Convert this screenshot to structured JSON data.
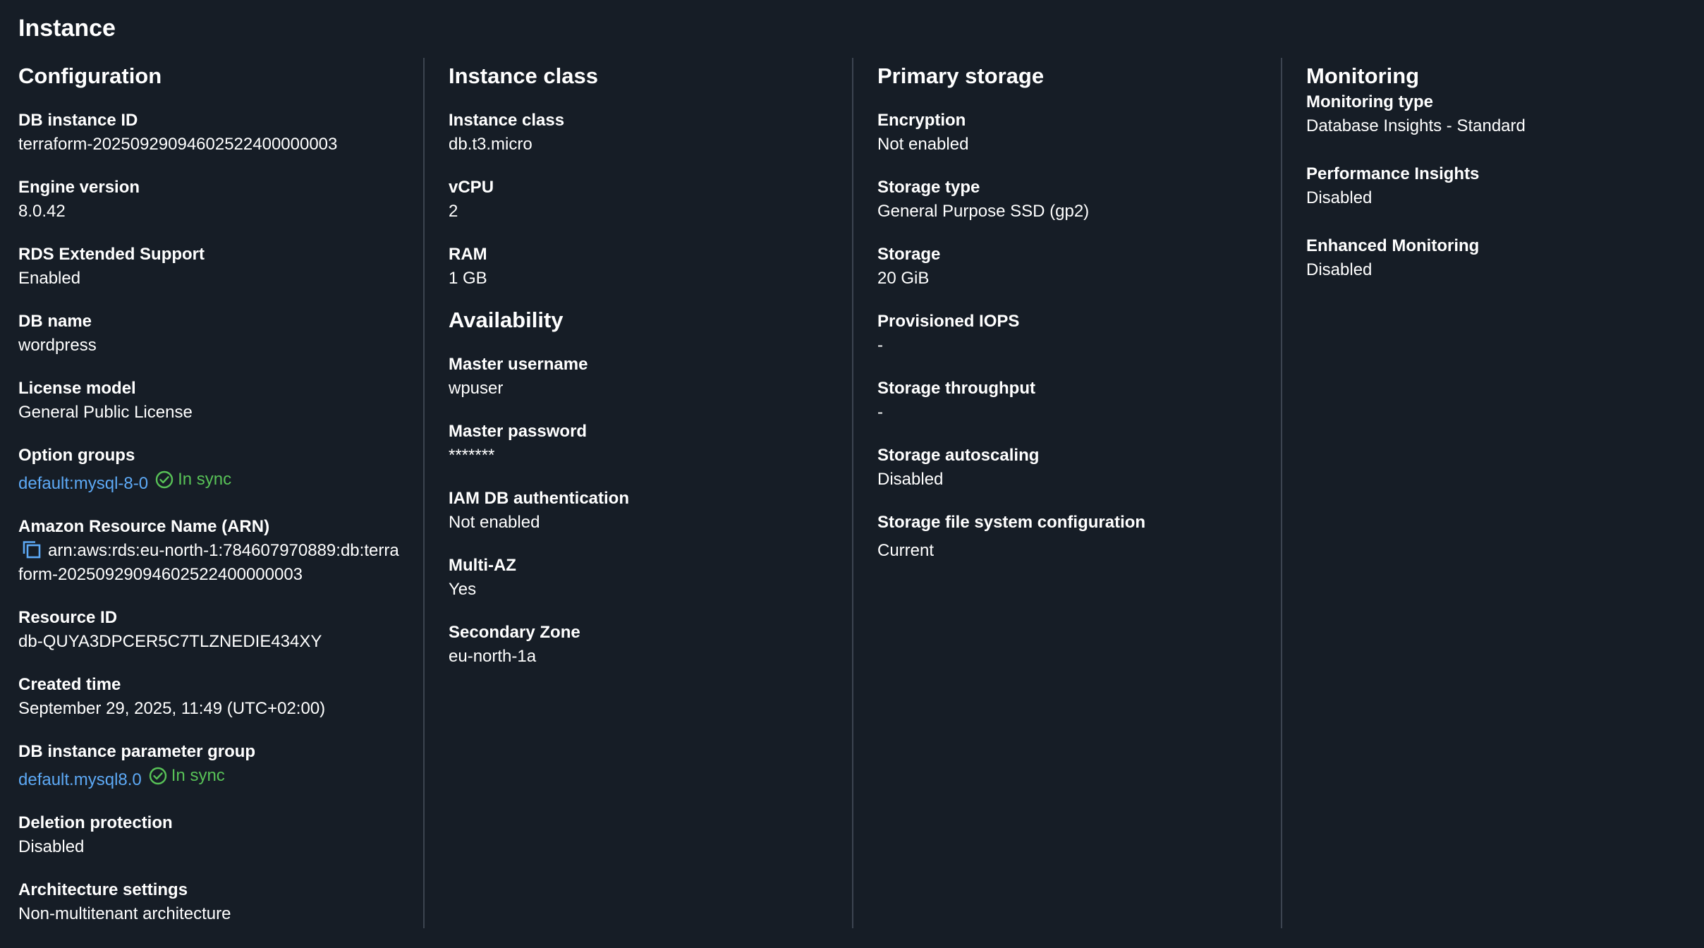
{
  "page": {
    "title": "Instance"
  },
  "configuration": {
    "title": "Configuration",
    "db_instance_id": {
      "label": "DB instance ID",
      "value": "terraform-20250929094602522400000003"
    },
    "engine_version": {
      "label": "Engine version",
      "value": "8.0.42"
    },
    "extended_support": {
      "label": "RDS Extended Support",
      "value": "Enabled"
    },
    "db_name": {
      "label": "DB name",
      "value": "wordpress"
    },
    "license_model": {
      "label": "License model",
      "value": "General Public License"
    },
    "option_groups": {
      "label": "Option groups",
      "link": "default:mysql-8-0",
      "status": "In sync"
    },
    "arn": {
      "label": "Amazon Resource Name (ARN)",
      "value": "arn:aws:rds:eu-north-1:784607970889:db:terraform-20250929094602522400000003"
    },
    "resource_id": {
      "label": "Resource ID",
      "value": "db-QUYA3DPCER5C7TLZNEDIE434XY"
    },
    "created_time": {
      "label": "Created time",
      "value": "September 29, 2025, 11:49 (UTC+02:00)"
    },
    "parameter_group": {
      "label": "DB instance parameter group",
      "link": "default.mysql8.0",
      "status": "In sync"
    },
    "deletion_protection": {
      "label": "Deletion protection",
      "value": "Disabled"
    },
    "architecture": {
      "label": "Architecture settings",
      "value": "Non-multitenant architecture"
    }
  },
  "instance_class": {
    "title": "Instance class",
    "class": {
      "label": "Instance class",
      "value": "db.t3.micro"
    },
    "vcpu": {
      "label": "vCPU",
      "value": "2"
    },
    "ram": {
      "label": "RAM",
      "value": "1 GB"
    }
  },
  "availability": {
    "title": "Availability",
    "master_username": {
      "label": "Master username",
      "value": "wpuser"
    },
    "master_password": {
      "label": "Master password",
      "value": "*******"
    },
    "iam_auth": {
      "label": "IAM DB authentication",
      "value": "Not enabled"
    },
    "multi_az": {
      "label": "Multi-AZ",
      "value": "Yes"
    },
    "secondary_zone": {
      "label": "Secondary Zone",
      "value": "eu-north-1a"
    }
  },
  "primary_storage": {
    "title": "Primary storage",
    "encryption": {
      "label": "Encryption",
      "value": "Not enabled"
    },
    "storage_type": {
      "label": "Storage type",
      "value": "General Purpose SSD (gp2)"
    },
    "storage": {
      "label": "Storage",
      "value": "20 GiB"
    },
    "iops": {
      "label": "Provisioned IOPS",
      "value": "-"
    },
    "throughput": {
      "label": "Storage throughput",
      "value": "-"
    },
    "autoscaling": {
      "label": "Storage autoscaling",
      "value": "Disabled"
    },
    "fs_config": {
      "label": "Storage file system configuration",
      "value": "Current"
    }
  },
  "monitoring": {
    "title": "Monitoring",
    "type": {
      "label": "Monitoring type",
      "value": "Database Insights - Standard"
    },
    "performance_insights": {
      "label": "Performance Insights",
      "value": "Disabled"
    },
    "enhanced": {
      "label": "Enhanced Monitoring",
      "value": "Disabled"
    }
  },
  "colors": {
    "background": "#161d26",
    "link": "#5da9f5",
    "success": "#58c257",
    "divider": "#3c4450"
  },
  "icons": {
    "status": "check-circle-icon",
    "copy": "copy-icon"
  }
}
